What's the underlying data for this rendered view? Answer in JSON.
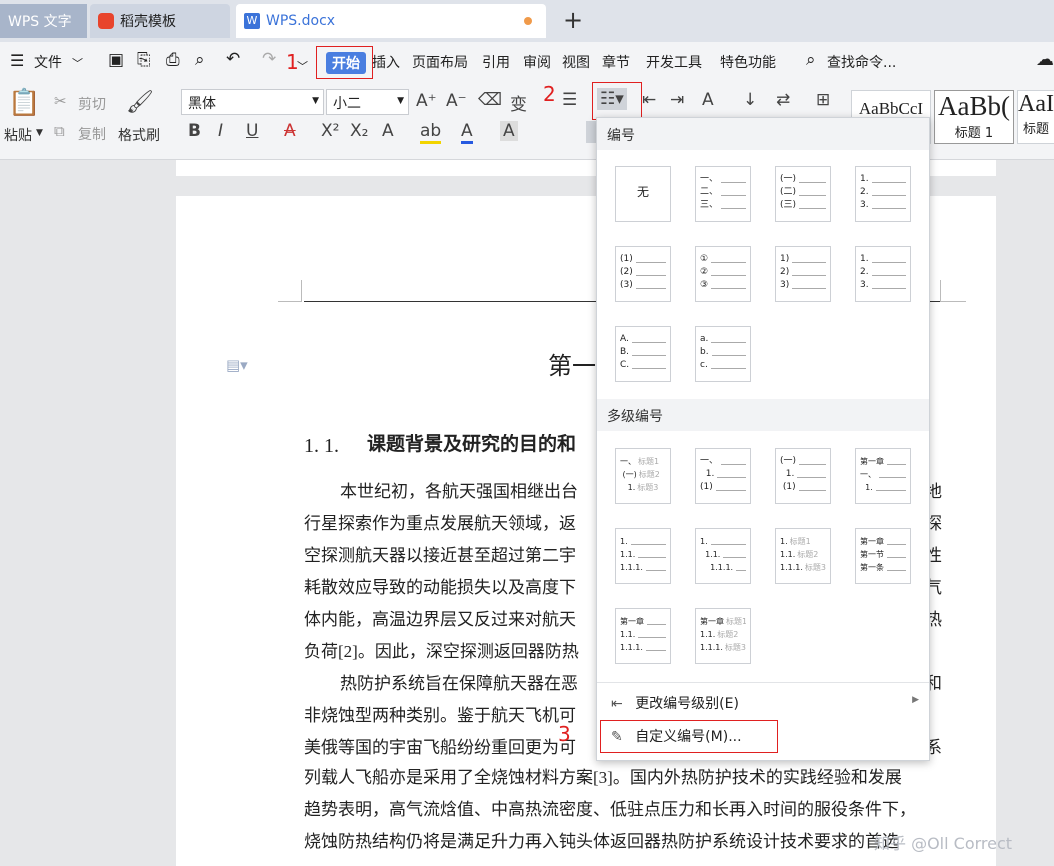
{
  "tabs": [
    {
      "label": "WPS 文字"
    },
    {
      "label": "稻壳模板"
    },
    {
      "label": "WPS.docx"
    }
  ],
  "menubar": {
    "file": "文件",
    "items": [
      "开始",
      "插入",
      "页面布局",
      "引用",
      "审阅",
      "视图",
      "章节",
      "开发工具",
      "特色功能"
    ],
    "search": "查找命令..."
  },
  "ribbon": {
    "paste": "粘贴",
    "cut": "剪切",
    "copy": "复制",
    "format_painter": "格式刷",
    "font_name": "黑体",
    "font_size": "小二",
    "style_preview_1": "AaBbCcI",
    "style_preview_2": "AaBb(",
    "style_preview_3": "AaI",
    "style_label_1": "标题 1",
    "style_label_2": "标题"
  },
  "document": {
    "chapter_partial": "第一",
    "heading_number": "1. 1.",
    "heading_text": "课题背景及研究的目的和",
    "lines": [
      "本世纪初，各航天强国相继出台",
      "行星探索作为重点发展航天领域，返",
      "空探测航天器以接近甚至超过第二宇",
      "耗散效应导致的动能损失以及高度下",
      "体内能，高温边界层又反过来对航天",
      "负荷[2]。因此，深空探测返回器防热",
      "热防护系统旨在保障航天器在恶",
      "非烧蚀型两种类别。鉴于航天飞机可",
      "美俄等国的宇宙飞船纷纷重回更为可",
      "列载人飞船亦是采用了全烧蚀材料方案[3]。国内外热防护技术的实践经验和发展",
      "趋势表明，高气流焓值、中高热流密度、低驻点压力和长再入时间的服役条件下，",
      "烧蚀防热结构仍将是满足升力再入钝头体返回器热防护系统设计技术要求的首选"
    ],
    "right_edge_chars": [
      "地",
      "探",
      "性",
      "气",
      "热",
      "和",
      "系"
    ]
  },
  "dropdown": {
    "section_numbering": "编号",
    "none_label": "无",
    "section_multilevel": "多级编号",
    "change_level": "更改编号级别(E)",
    "custom": "自定义编号(M)..."
  },
  "annotations": {
    "n1": "1",
    "n2": "2",
    "n3": "3"
  },
  "watermark": "知乎 @Oll Correct",
  "colors": {
    "accent": "#4a7ee0",
    "red_annotation": "#e02020"
  }
}
